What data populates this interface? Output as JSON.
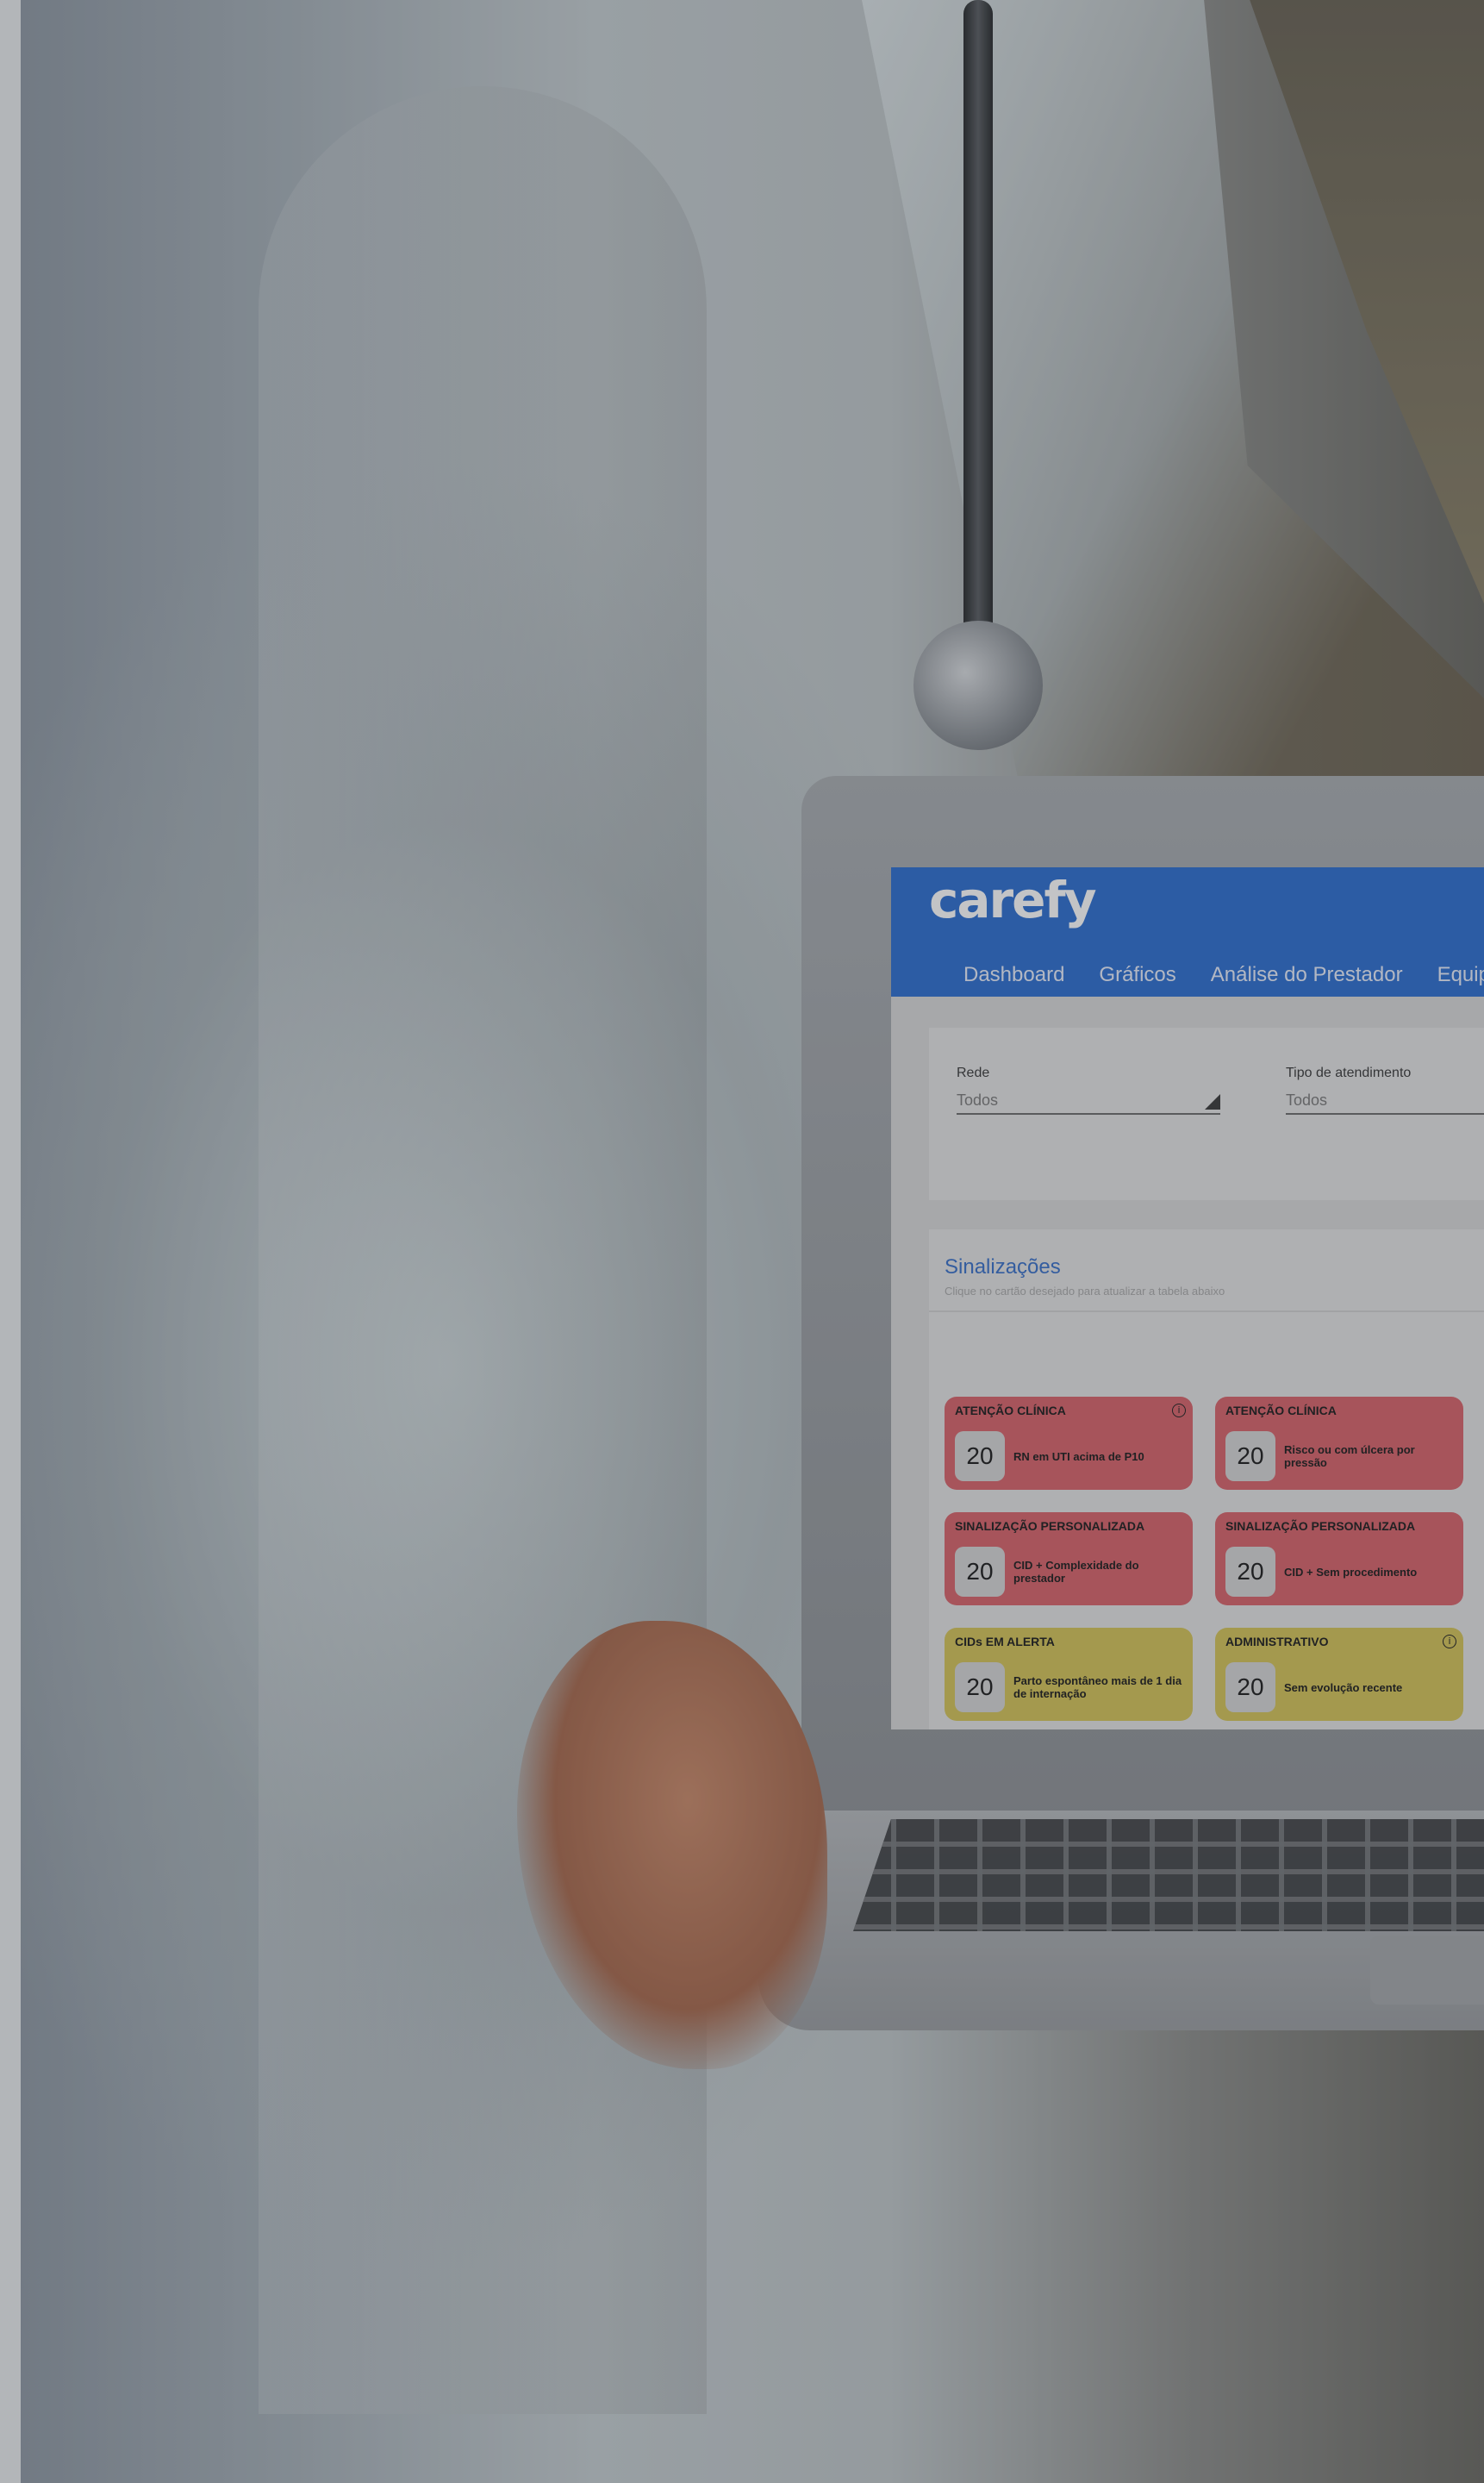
{
  "app": {
    "logo_text": "carefy",
    "brand_color": "#2f6fd0"
  },
  "nav": {
    "items": [
      {
        "label": "Dashboard"
      },
      {
        "label": "Gráficos"
      },
      {
        "label": "Análise do Prestador"
      },
      {
        "label": "Equipe"
      }
    ]
  },
  "filters": {
    "rede": {
      "label": "Rede",
      "value": "Todos"
    },
    "tipo_atendimento": {
      "label": "Tipo de atendimento",
      "value": "Todos"
    }
  },
  "signals": {
    "title": "Sinalizações",
    "hint": "Clique no cartão desejado para atualizar a tabela abaixo",
    "cards": [
      {
        "category": "ATENÇÃO CLÍNICA",
        "count": "20",
        "text": "RN em UTI acima de P10",
        "color": "red",
        "info": true
      },
      {
        "category": "ATENÇÃO CLÍNICA",
        "count": "20",
        "text": "Risco ou com úlcera por pressão",
        "color": "red",
        "info": false
      },
      {
        "category": "SINALIZAÇÃO PERSONALIZADA",
        "count": "20",
        "text": "CID + Complexidade do prestador",
        "color": "red",
        "info": false
      },
      {
        "category": "SINALIZAÇÃO PERSONALIZADA",
        "count": "20",
        "text": "CID + Sem procedimento",
        "color": "red",
        "info": false
      },
      {
        "category": "CIDs EM ALERTA",
        "count": "20",
        "text": "Parto espontâneo mais de 1 dia de internação",
        "color": "yellow",
        "info": false
      },
      {
        "category": "ADMINISTRATIVO",
        "count": "20",
        "text": "Sem evolução recente",
        "color": "yellow",
        "info": true
      }
    ],
    "colors": {
      "red": "#d9646b",
      "yellow": "#d4c459"
    }
  }
}
